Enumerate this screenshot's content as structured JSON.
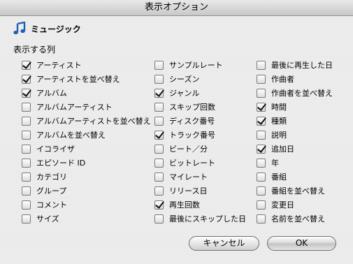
{
  "window": {
    "title": "表示オプション"
  },
  "header": {
    "label": "ミュージック",
    "icon": "music-note-icon"
  },
  "section": {
    "label": "表示する列"
  },
  "columns": [
    [
      {
        "label": "アーティスト",
        "checked": true
      },
      {
        "label": "アーティストを並べ替え",
        "checked": true
      },
      {
        "label": "アルバム",
        "checked": true
      },
      {
        "label": "アルバムアーティスト",
        "checked": false
      },
      {
        "label": "アルバムアーティストを並べ替え",
        "checked": false
      },
      {
        "label": "アルバムを並べ替え",
        "checked": false
      },
      {
        "label": "イコライザ",
        "checked": false
      },
      {
        "label": "エピソード ID",
        "checked": false
      },
      {
        "label": "カテゴリ",
        "checked": false
      },
      {
        "label": "グループ",
        "checked": false
      },
      {
        "label": "コメント",
        "checked": false
      },
      {
        "label": "サイズ",
        "checked": false
      }
    ],
    [
      {
        "label": "サンプルレート",
        "checked": false
      },
      {
        "label": "シーズン",
        "checked": false
      },
      {
        "label": "ジャンル",
        "checked": true
      },
      {
        "label": "スキップ回数",
        "checked": false
      },
      {
        "label": "ディスク番号",
        "checked": false
      },
      {
        "label": "トラック番号",
        "checked": true
      },
      {
        "label": "ビート／分",
        "checked": false
      },
      {
        "label": "ビットレート",
        "checked": false
      },
      {
        "label": "マイレート",
        "checked": false
      },
      {
        "label": "リリース日",
        "checked": false
      },
      {
        "label": "再生回数",
        "checked": true
      },
      {
        "label": "最後にスキップした日",
        "checked": false
      }
    ],
    [
      {
        "label": "最後に再生した日",
        "checked": false
      },
      {
        "label": "作曲者",
        "checked": false
      },
      {
        "label": "作曲者を並べ替え",
        "checked": false
      },
      {
        "label": "時間",
        "checked": true
      },
      {
        "label": "種類",
        "checked": true
      },
      {
        "label": "説明",
        "checked": false
      },
      {
        "label": "追加日",
        "checked": true
      },
      {
        "label": "年",
        "checked": false
      },
      {
        "label": "番組",
        "checked": false
      },
      {
        "label": "番組を並べ替え",
        "checked": false
      },
      {
        "label": "変更日",
        "checked": false
      },
      {
        "label": "名前を並べ替え",
        "checked": false
      }
    ]
  ],
  "buttons": {
    "cancel": "キャンセル",
    "ok": "OK"
  }
}
